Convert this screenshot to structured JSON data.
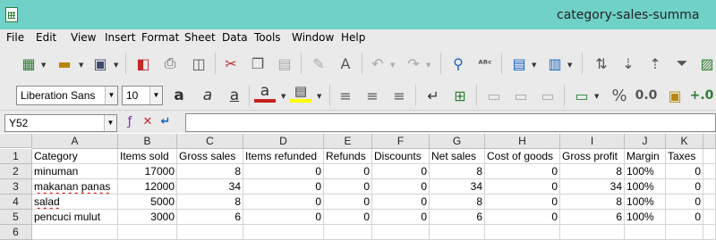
{
  "window": {
    "title": "category-sales-summa"
  },
  "menu": [
    "File",
    "Edit",
    "View",
    "Insert",
    "Format",
    "Sheet",
    "Data",
    "Tools",
    "Window",
    "Help"
  ],
  "toolbar": {
    "font_name": "Liberation Sans",
    "font_size": "10"
  },
  "formula_bar": {
    "cell_ref": "Y52",
    "content": ""
  },
  "sheet": {
    "columns": [
      "A",
      "B",
      "C",
      "D",
      "E",
      "F",
      "G",
      "H",
      "I",
      "J",
      "K"
    ],
    "rows": [
      "1",
      "2",
      "3",
      "4",
      "5",
      "6"
    ],
    "headers": [
      "Category",
      "Items sold",
      "Gross sales",
      "Items refunded",
      "Refunds",
      "Discounts",
      "Net sales",
      "Cost of goods",
      "Gross profit",
      "Margin",
      "Taxes"
    ],
    "data": [
      [
        "minuman",
        "17000",
        "8",
        "0",
        "0",
        "0",
        "8",
        "0",
        "8",
        "100%",
        "0"
      ],
      [
        "makanan panas",
        "12000",
        "34",
        "0",
        "0",
        "0",
        "34",
        "0",
        "34",
        "100%",
        "0"
      ],
      [
        "salad",
        "5000",
        "8",
        "0",
        "0",
        "0",
        "8",
        "0",
        "8",
        "100%",
        "0"
      ],
      [
        "pencuci mulut",
        "3000",
        "6",
        "0",
        "0",
        "0",
        "6",
        "0",
        "6",
        "100%",
        "0"
      ]
    ]
  }
}
